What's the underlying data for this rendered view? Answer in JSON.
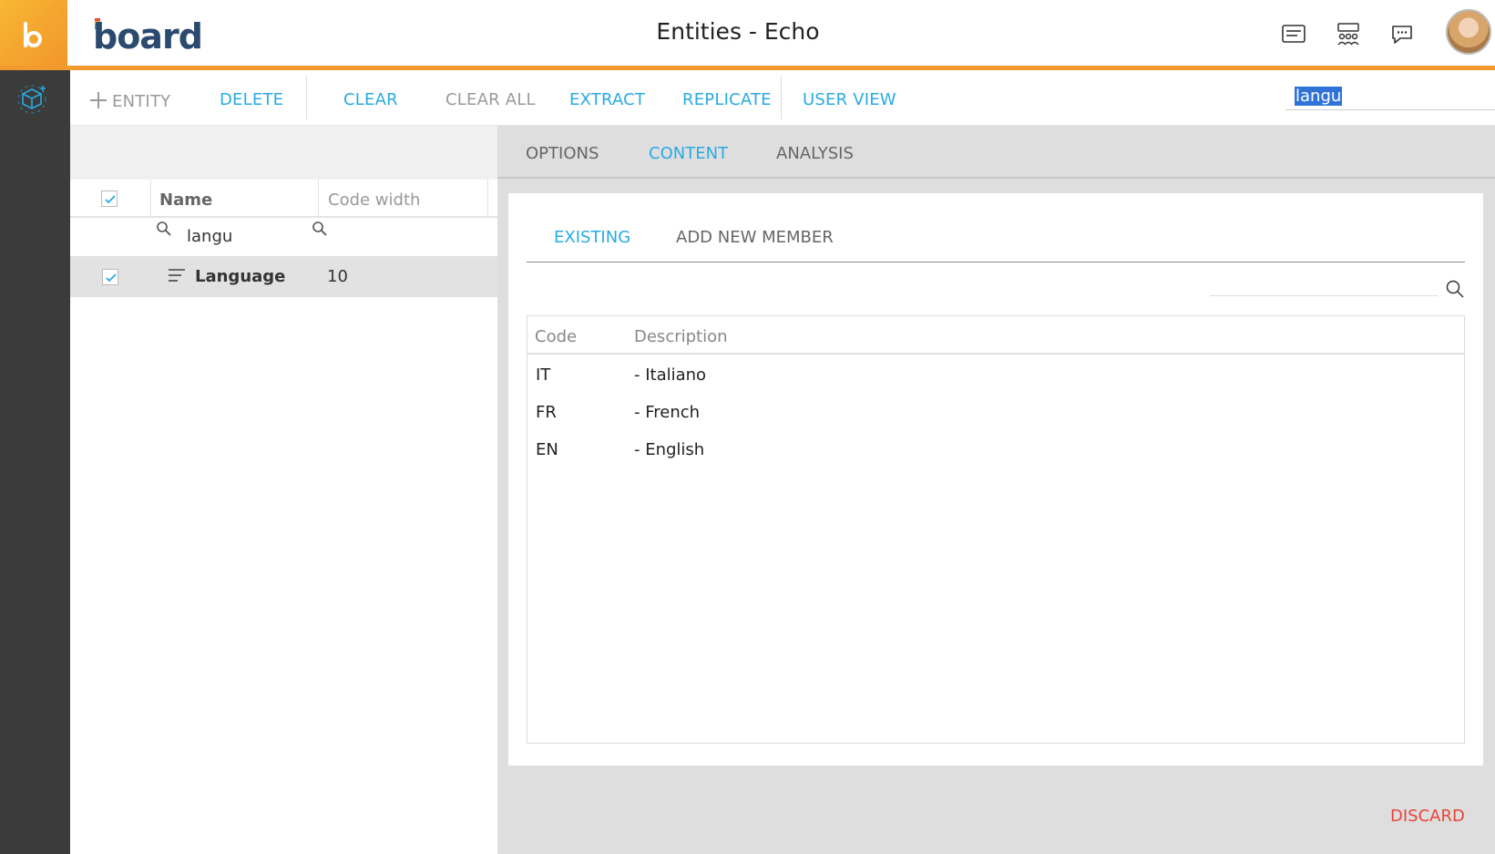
{
  "header": {
    "brand": "board",
    "title": "Entities - Echo",
    "icons": [
      "cards-icon",
      "organization-icon",
      "chat-icon"
    ],
    "avatar_icon": "user-avatar"
  },
  "rail": {
    "icons": [
      "cube-settings-icon"
    ]
  },
  "toolbar": {
    "entity_label": "ENTITY",
    "delete_label": "DELETE",
    "clear_label": "CLEAR",
    "clear_all_label": "CLEAR ALL",
    "extract_label": "EXTRACT",
    "replicate_label": "REPLICATE",
    "user_view_label": "USER VIEW",
    "search_value": "langu"
  },
  "list": {
    "columns": {
      "name": "Name",
      "code_width": "Code width"
    },
    "filter_value": "langu",
    "rows": [
      {
        "name": "Language",
        "code_width": "10",
        "checked": true
      }
    ]
  },
  "tabs": {
    "options": "OPTIONS",
    "content": "CONTENT",
    "analysis": "ANALYSIS",
    "active": "CONTENT"
  },
  "content": {
    "subtabs": {
      "existing": "EXISTING",
      "add_new": "ADD NEW MEMBER",
      "active": "EXISTING"
    },
    "table": {
      "headers": {
        "code": "Code",
        "description": "Description"
      },
      "rows": [
        {
          "code": "IT",
          "description": "- Italiano"
        },
        {
          "code": "FR",
          "description": "- French"
        },
        {
          "code": "EN",
          "description": "- English"
        }
      ]
    },
    "discard_label": "DISCARD"
  },
  "colors": {
    "accent": "#29abe2",
    "orange": "#f29a2e",
    "danger": "#e8443a",
    "rail": "#3b3b3b"
  }
}
